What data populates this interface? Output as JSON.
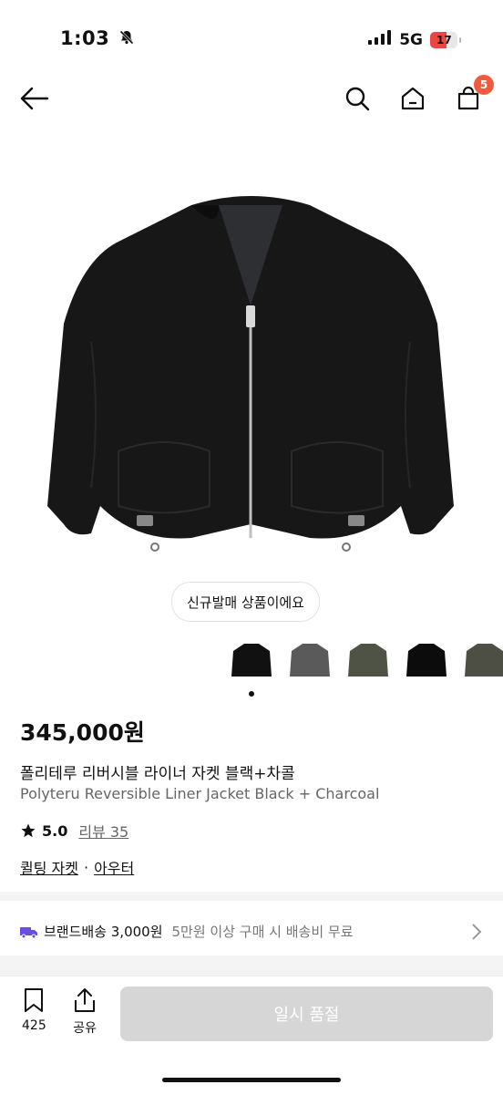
{
  "status_bar": {
    "time": "1:03",
    "network": "5G",
    "battery": "17"
  },
  "header": {
    "cart_count": "5"
  },
  "product": {
    "new_badge": "신규발매 상품이에요",
    "price": "345,000원",
    "title_ko": "폴리테루 리버시블 라이너 자켓 블랙+차콜",
    "title_en": "Polyteru Reversible Liner Jacket Black + Charcoal",
    "rating": "5.0",
    "reviews": "리뷰 35",
    "category": "퀼팅 자켓",
    "category_separator": "·",
    "parent_category": "아우터",
    "thumb_colors": [
      "#111111",
      "#5a5a5a",
      "#4f5346",
      "#0c0c0c",
      "#4e4f44"
    ]
  },
  "shipping": {
    "label": "브랜드배송 3,000원",
    "free_condition": "5만원 이상 구매 시 배송비 무료"
  },
  "bottom_bar": {
    "bookmark_count": "425",
    "share_label": "공유",
    "soldout_label": "일시 품절"
  }
}
